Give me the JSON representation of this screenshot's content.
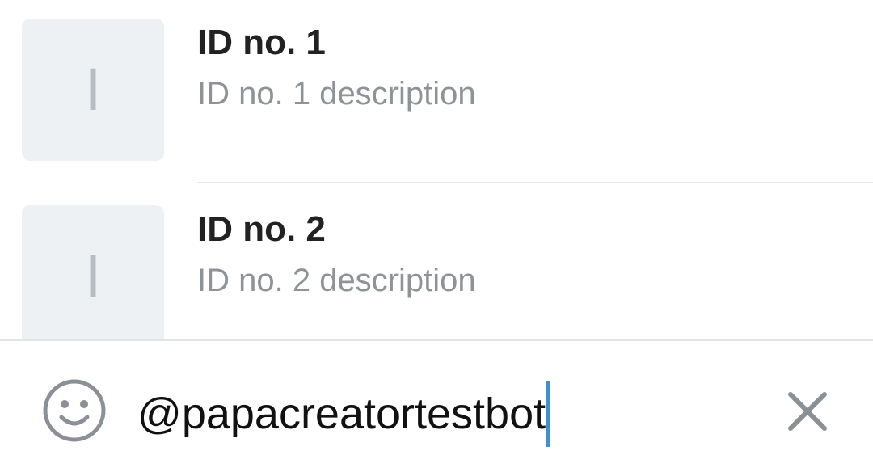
{
  "results": [
    {
      "thumb_letter": "I",
      "title": "ID no. 1",
      "description": "ID no. 1 description"
    },
    {
      "thumb_letter": "I",
      "title": "ID no. 2",
      "description": "ID no. 2 description"
    }
  ],
  "input": {
    "value": "@papacreatortestbot",
    "emoji_icon": "smiley-icon",
    "clear_icon": "close-icon"
  },
  "colors": {
    "caret": "#3d8fd6",
    "thumb_bg": "#eef1f4",
    "title": "#222222",
    "description": "#8e9398"
  }
}
